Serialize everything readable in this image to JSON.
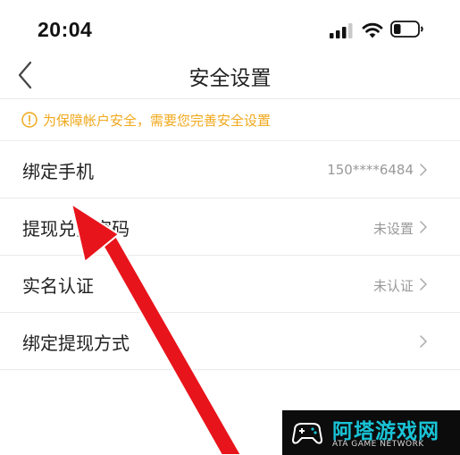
{
  "status_bar": {
    "time": "20:04",
    "icons": [
      "cellular-signal-icon",
      "wifi-icon",
      "battery-icon"
    ],
    "battery_level": 0.3
  },
  "nav": {
    "title": "安全设置",
    "back_icon": "chevron-left-icon"
  },
  "notice": {
    "icon": "warning-circle-icon",
    "text": "为保障帐户安全，需要您完善安全设置",
    "color": "#f0a81c"
  },
  "rows": [
    {
      "label": "绑定手机",
      "value": "150****6484"
    },
    {
      "label": "提现兑换密码",
      "value": "未设置"
    },
    {
      "label": "实名认证",
      "value": "未认证"
    },
    {
      "label": "绑定提现方式",
      "value": ""
    }
  ],
  "overlay": {
    "arrow_color": "#e8141c"
  },
  "watermark": {
    "name": "阿塔游戏网",
    "subtitle": "ATA GAME NETWORK",
    "accent": "#19c3d6"
  }
}
